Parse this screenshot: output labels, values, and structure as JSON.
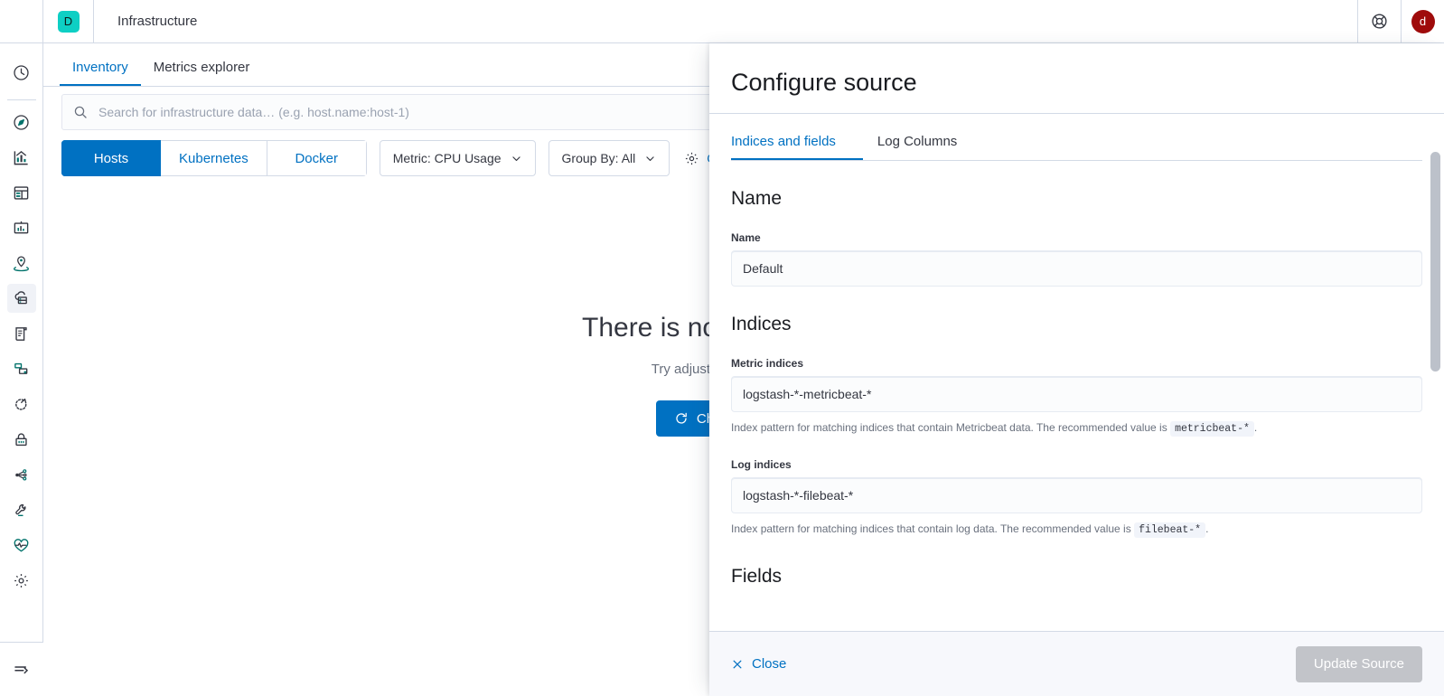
{
  "header": {
    "logo_icon": "kibana-logo",
    "space_badge": "D",
    "title": "Infrastructure",
    "help_icon": "lifebuoy-icon",
    "avatar_initial": "d",
    "avatar_color": "#9f0b0b",
    "space_color": "#0ecfc4"
  },
  "sidebar": {
    "recent_icon": "clock-icon",
    "items": [
      {
        "icon": "discover-icon",
        "name": "discover",
        "selected": false
      },
      {
        "icon": "visualize-icon",
        "name": "visualize",
        "selected": false
      },
      {
        "icon": "dashboard-icon",
        "name": "dashboard",
        "selected": false
      },
      {
        "icon": "canvas-icon",
        "name": "canvas",
        "selected": false
      },
      {
        "icon": "maps-icon",
        "name": "maps",
        "selected": false
      },
      {
        "icon": "infrastructure-icon",
        "name": "infrastructure",
        "selected": true
      },
      {
        "icon": "logs-icon",
        "name": "logs",
        "selected": false
      },
      {
        "icon": "apm-icon",
        "name": "apm",
        "selected": false
      },
      {
        "icon": "uptime-icon",
        "name": "uptime",
        "selected": false
      },
      {
        "icon": "siem-lock-icon",
        "name": "siem",
        "selected": false
      },
      {
        "icon": "graph-icon",
        "name": "graph",
        "selected": false
      },
      {
        "icon": "dev-tools-icon",
        "name": "dev-tools",
        "selected": false
      },
      {
        "icon": "monitoring-heart-icon",
        "name": "monitoring",
        "selected": false
      },
      {
        "icon": "management-gear-icon",
        "name": "management",
        "selected": false
      }
    ],
    "collapse_icon": "menu-collapse-icon"
  },
  "appnav": {
    "tabs": [
      {
        "label": "Inventory",
        "active": true
      },
      {
        "label": "Metrics explorer",
        "active": false
      }
    ]
  },
  "toolbar": {
    "search_icon": "search-icon",
    "search_placeholder": "Search for infrastructure data… (e.g. host.name:host-1)",
    "search_value": "",
    "node_types": [
      {
        "label": "Hosts",
        "active": true
      },
      {
        "label": "Kubernetes",
        "active": false
      },
      {
        "label": "Docker",
        "active": false
      }
    ],
    "metric_select": "Metric: CPU Usage",
    "groupby_select": "Group By: All",
    "configure_icon": "gear-icon",
    "configure_label": "Configure source",
    "chevron_icon": "chevron-down-icon"
  },
  "empty_state": {
    "title": "There is no data to display.",
    "subtitle": "Try adjusting your time or filter.",
    "refresh_icon": "refresh-icon",
    "button_label": "Check for new data"
  },
  "flyout": {
    "title": "Configure source",
    "tabs": [
      {
        "label": "Indices and fields",
        "active": true
      },
      {
        "label": "Log Columns",
        "active": false
      }
    ],
    "sections": {
      "name": {
        "heading": "Name",
        "field_label": "Name",
        "field_value": "Default"
      },
      "indices": {
        "heading": "Indices",
        "metric": {
          "label": "Metric indices",
          "value": "logstash-*-metricbeat-*",
          "help_prefix": "Index pattern for matching indices that contain Metricbeat data. The recommended value is",
          "help_code": "metricbeat-*",
          "help_suffix": "."
        },
        "log": {
          "label": "Log indices",
          "value": "logstash-*-filebeat-*",
          "help_prefix": "Index pattern for matching indices that contain log data. The recommended value is",
          "help_code": "filebeat-*",
          "help_suffix": "."
        }
      },
      "fields": {
        "heading": "Fields"
      }
    },
    "footer": {
      "close_icon": "close-x-icon",
      "close_label": "Close",
      "update_label": "Update Source",
      "update_disabled": true
    },
    "scrollbar": {
      "visible": true
    }
  },
  "colors": {
    "primary": "#0071c2",
    "border": "#d3dae6",
    "text": "#343741",
    "subdued": "#69707d"
  }
}
